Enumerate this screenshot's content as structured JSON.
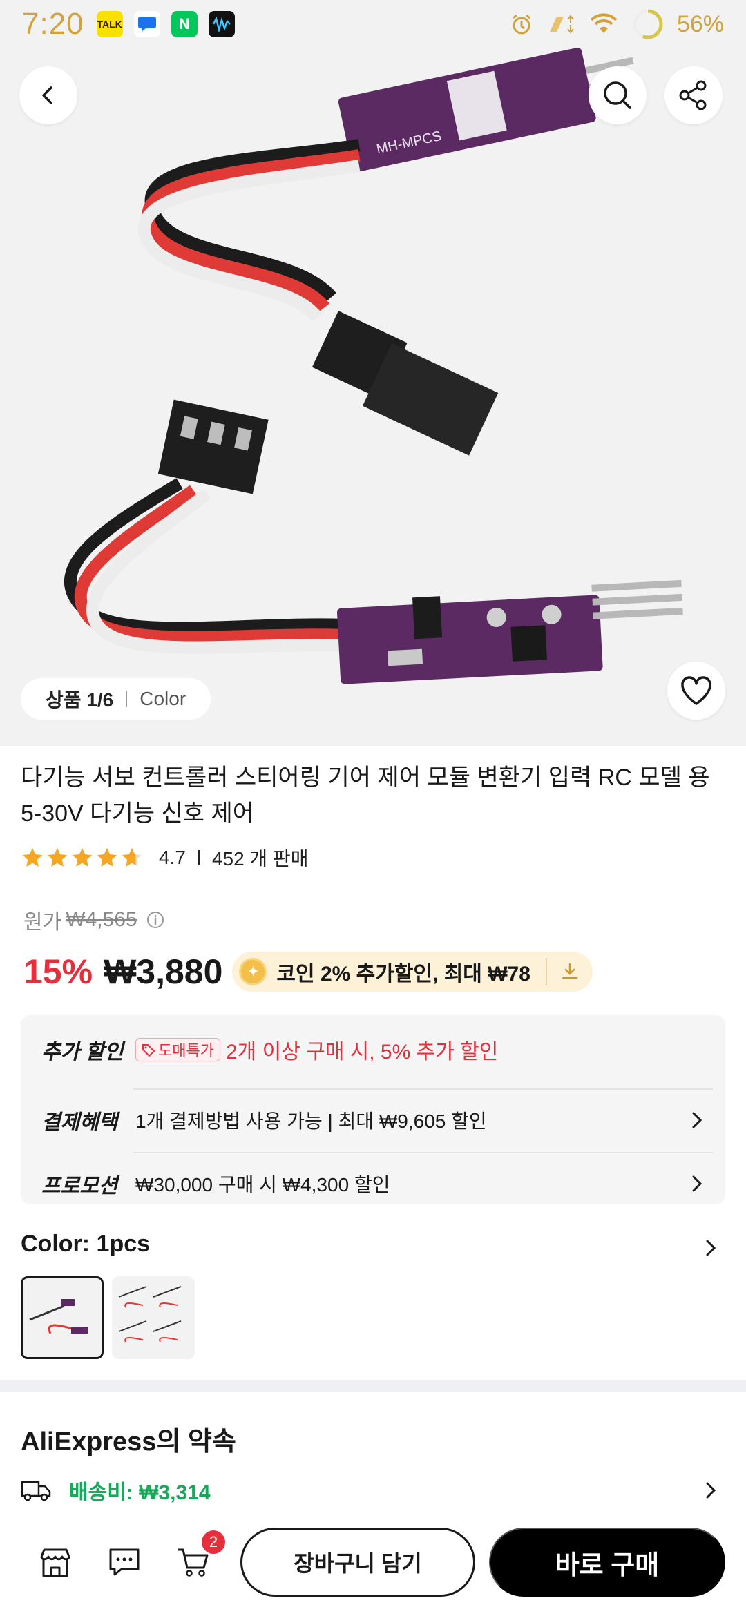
{
  "status_bar": {
    "time": "7:20",
    "battery_percent": "56%",
    "apps": [
      {
        "name": "kakaotalk",
        "label": "TALK",
        "color": "#f9e000",
        "text_color": "#3c1e1e"
      },
      {
        "name": "messages",
        "label": "",
        "color": "#ffffff",
        "text_color": "#1a73e8"
      },
      {
        "name": "naver",
        "label": "N",
        "color": "#03c75a",
        "text_color": "#ffffff"
      },
      {
        "name": "wave",
        "label": "",
        "color": "#111111",
        "text_color": "#ffffff"
      }
    ]
  },
  "header": {
    "back_icon": "chevron-left-icon",
    "search_icon": "search-icon",
    "share_icon": "share-icon"
  },
  "gallery": {
    "page_label": "상품 1/6",
    "variant_label": "Color",
    "wishlist_icon": "heart-icon"
  },
  "product": {
    "title": "다기능 서보 컨트롤러 스티어링 기어 제어 모듈 변환기 입력 RC 모델 용 5-30V 다기능 신호 제어",
    "rating": "4.7",
    "sold": "452 개 판매"
  },
  "price": {
    "original_label": "원가",
    "original_price": "₩4,565",
    "discount": "15%",
    "current": "₩3,880",
    "coin_offer": "코인 2% 추가할인, 최대 ₩78"
  },
  "promos": {
    "extra_label": "추가 할인",
    "wholesale_tag": "도매특가",
    "extra_text": "2개 이상 구매 시, 5% 추가 할인",
    "payment_label": "결제혜택",
    "payment_text": "1개 결제방법 사용 가능 | 최대 ₩9,605 할인",
    "promotion_label": "프로모션",
    "promotion_text": "₩30,000 구매 시 ₩4,300 할인"
  },
  "color": {
    "title": "Color: 1pcs"
  },
  "promise": {
    "title": "AliExpress의 약속",
    "shipping": "배송비: ₩3,314"
  },
  "bottom_bar": {
    "cart_count": "2",
    "add_to_cart": "장바구니 담기",
    "buy_now": "바로 구매"
  },
  "colors": {
    "accent_red": "#e62e3d",
    "status_gold": "#d1a33a",
    "shipping_green": "#1aa85b"
  }
}
